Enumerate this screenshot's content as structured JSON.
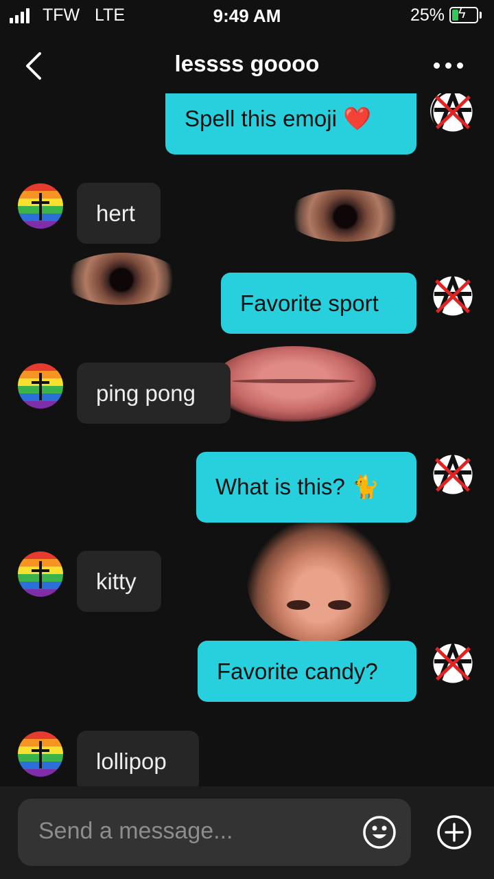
{
  "status": {
    "carrier": "TFW",
    "network": "LTE",
    "time": "9:49 AM",
    "battery_percent": "25%",
    "battery_level": 0.25
  },
  "header": {
    "title": "lessss goooo"
  },
  "messages": [
    {
      "dir": "out",
      "text": "Spell this emoji ❤️"
    },
    {
      "dir": "in",
      "text": "hert"
    },
    {
      "dir": "out",
      "text": "Favorite sport"
    },
    {
      "dir": "in",
      "text": "ping pong"
    },
    {
      "dir": "out",
      "text": "What is this? 🐈"
    },
    {
      "dir": "in",
      "text": "kitty"
    },
    {
      "dir": "out",
      "text": "Favorite candy?"
    },
    {
      "dir": "in",
      "text": "lollipop"
    }
  ],
  "composer": {
    "placeholder": "Send a message..."
  },
  "colors": {
    "outgoing_bubble": "#27d0dc",
    "incoming_bubble": "#262626",
    "background": "#111111"
  },
  "icons": [
    "back-chevron-icon",
    "more-dots-icon",
    "emoji-icon",
    "plus-icon"
  ]
}
